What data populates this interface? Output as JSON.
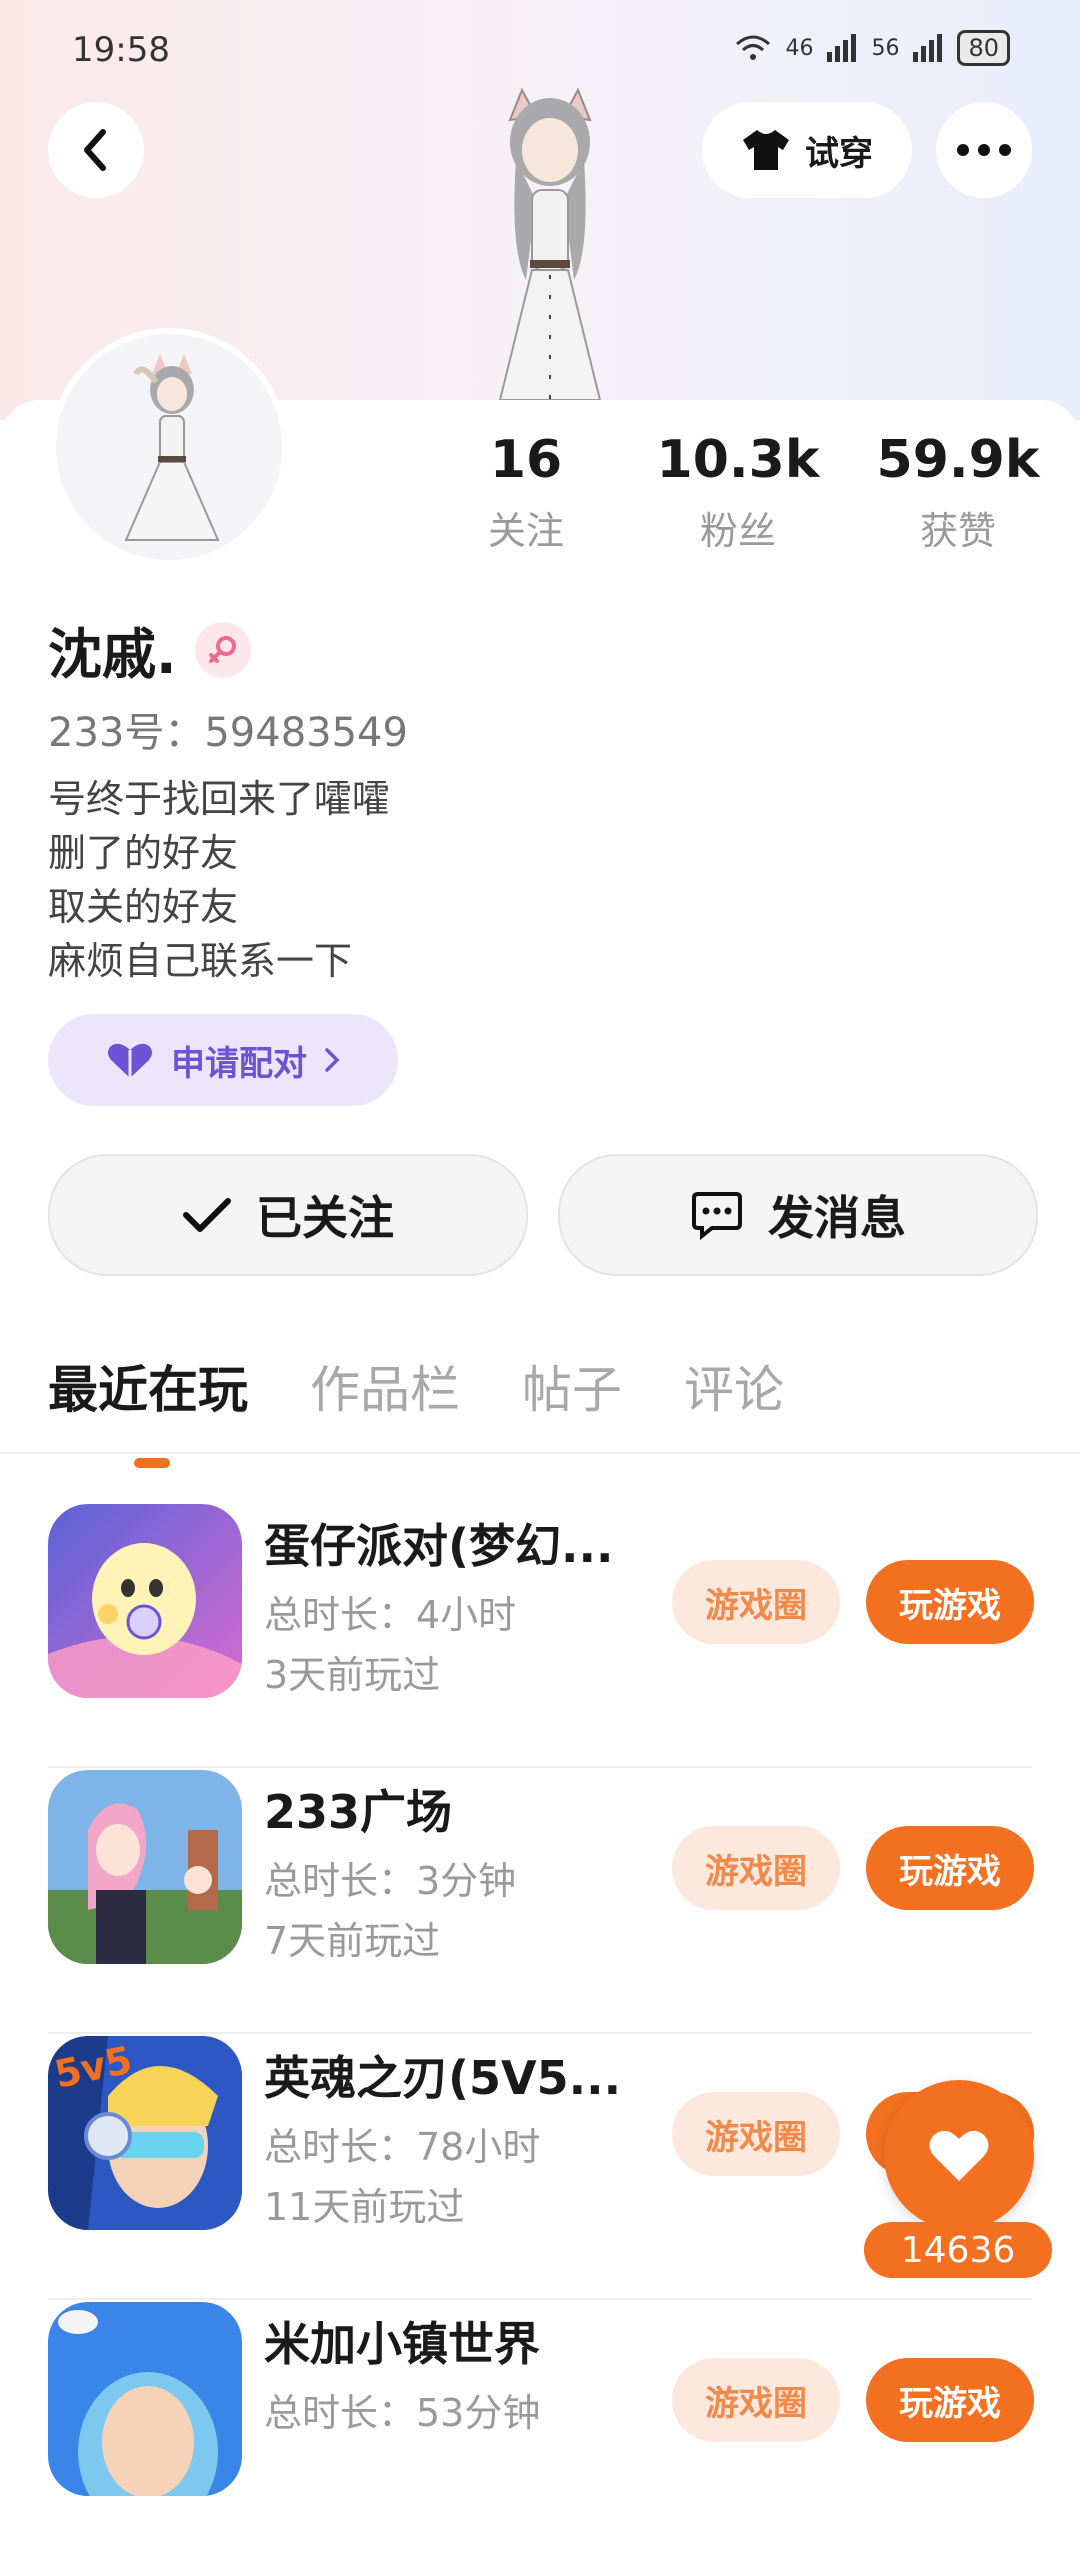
{
  "status_bar": {
    "time": "19:58",
    "net1": "46",
    "net2": "56",
    "battery": "80"
  },
  "header": {
    "tryon_label": "试穿"
  },
  "stats": [
    {
      "value": "16",
      "label": "关注"
    },
    {
      "value": "10.3k",
      "label": "粉丝"
    },
    {
      "value": "59.9k",
      "label": "获赞"
    }
  ],
  "profile": {
    "name": "沈戚.",
    "id_text": "233号：59483549",
    "bio": [
      "号终于找回来了嚯嚯",
      "删了的好友",
      "取关的好友",
      "麻烦自己联系一下"
    ],
    "pair_label": "申请配对"
  },
  "actions": {
    "followed_label": "已关注",
    "message_label": "发消息"
  },
  "tabs": [
    "最近在玩",
    "作品栏",
    "帖子",
    "评论"
  ],
  "games": [
    {
      "name": "蛋仔派对(梦幻...",
      "duration": "总时长：4小时",
      "last_played": "3天前玩过"
    },
    {
      "name": "233广场",
      "duration": "总时长：3分钟",
      "last_played": "7天前玩过"
    },
    {
      "name": "英魂之刃(5V5...",
      "duration": "总时长：78小时",
      "last_played": "11天前玩过"
    },
    {
      "name": "米加小镇世界",
      "duration": "总时长：53分钟",
      "last_played": ""
    }
  ],
  "game_buttons": {
    "circle_label": "游戏圈",
    "play_label": "玩游戏"
  },
  "like": {
    "count": "14636"
  },
  "colors": {
    "accent": "#f37021",
    "pair": "#6b55d6"
  }
}
